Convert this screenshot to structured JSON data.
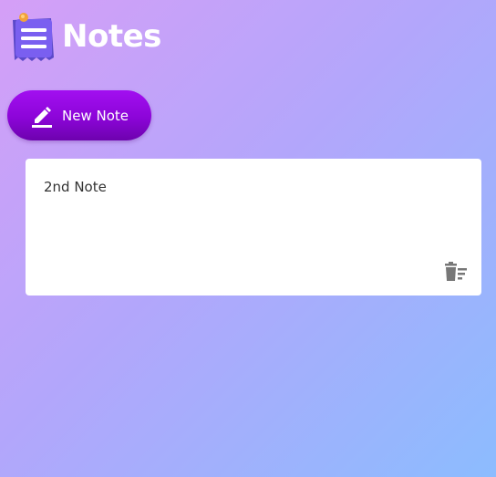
{
  "app": {
    "title": "Notes",
    "logo_icon": "notepad-icon"
  },
  "toolbar": {
    "new_note_label": "New Note",
    "new_note_icon": "pencil-icon"
  },
  "notes": [
    {
      "text": "2nd Note",
      "delete_icon": "delete-sweep-icon"
    }
  ],
  "colors": {
    "background_start": "#d59ff7",
    "background_end": "#8cbcfe",
    "button": "#8c05d8",
    "card": "#ffffff",
    "delete_icon": "#777777"
  }
}
